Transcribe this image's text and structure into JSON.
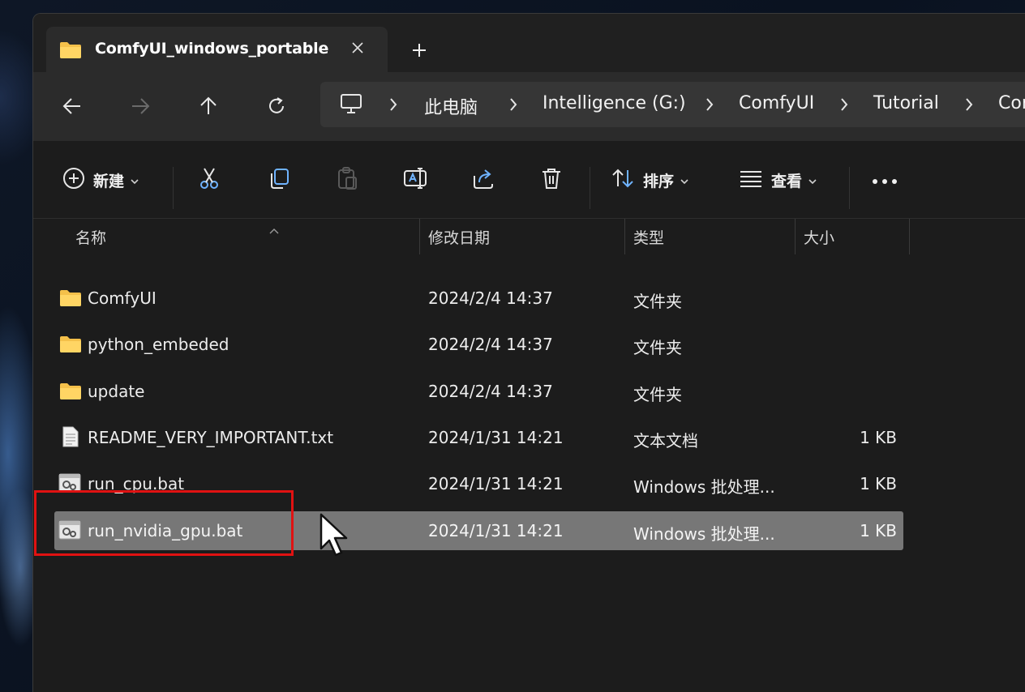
{
  "tab": {
    "title": "ComfyUI_windows_portable",
    "icon": "folder-icon"
  },
  "nav": {
    "back_icon": "arrow-left-icon",
    "forward_icon": "arrow-right-icon",
    "up_icon": "arrow-up-icon",
    "refresh_icon": "refresh-icon"
  },
  "breadcrumb": {
    "root_icon": "monitor-icon",
    "items": [
      "此电脑",
      "Intelligence (G:)",
      "ComfyUI",
      "Tutorial",
      "Cor"
    ]
  },
  "toolbar": {
    "new_label": "新建",
    "sort_label": "排序",
    "view_label": "查看"
  },
  "columns": {
    "name": "名称",
    "date": "修改日期",
    "type": "类型",
    "size": "大小"
  },
  "files": [
    {
      "name": "ComfyUI",
      "date": "2024/2/4 14:37",
      "type": "文件夹",
      "size": "",
      "icon": "folder-icon"
    },
    {
      "name": "python_embeded",
      "date": "2024/2/4 14:37",
      "type": "文件夹",
      "size": "",
      "icon": "folder-icon"
    },
    {
      "name": "update",
      "date": "2024/2/4 14:37",
      "type": "文件夹",
      "size": "",
      "icon": "folder-icon"
    },
    {
      "name": "README_VERY_IMPORTANT.txt",
      "date": "2024/1/31 14:21",
      "type": "文本文档",
      "size": "1 KB",
      "icon": "text-file-icon"
    },
    {
      "name": "run_cpu.bat",
      "date": "2024/1/31 14:21",
      "type": "Windows 批处理...",
      "size": "1 KB",
      "icon": "batch-file-icon"
    },
    {
      "name": "run_nvidia_gpu.bat",
      "date": "2024/1/31 14:21",
      "type": "Windows 批处理...",
      "size": "1 KB",
      "icon": "batch-file-icon",
      "selected": true
    }
  ],
  "colors": {
    "window_bg": "#1c1c1c",
    "selection": "#777777",
    "highlight_box": "#e01212"
  }
}
